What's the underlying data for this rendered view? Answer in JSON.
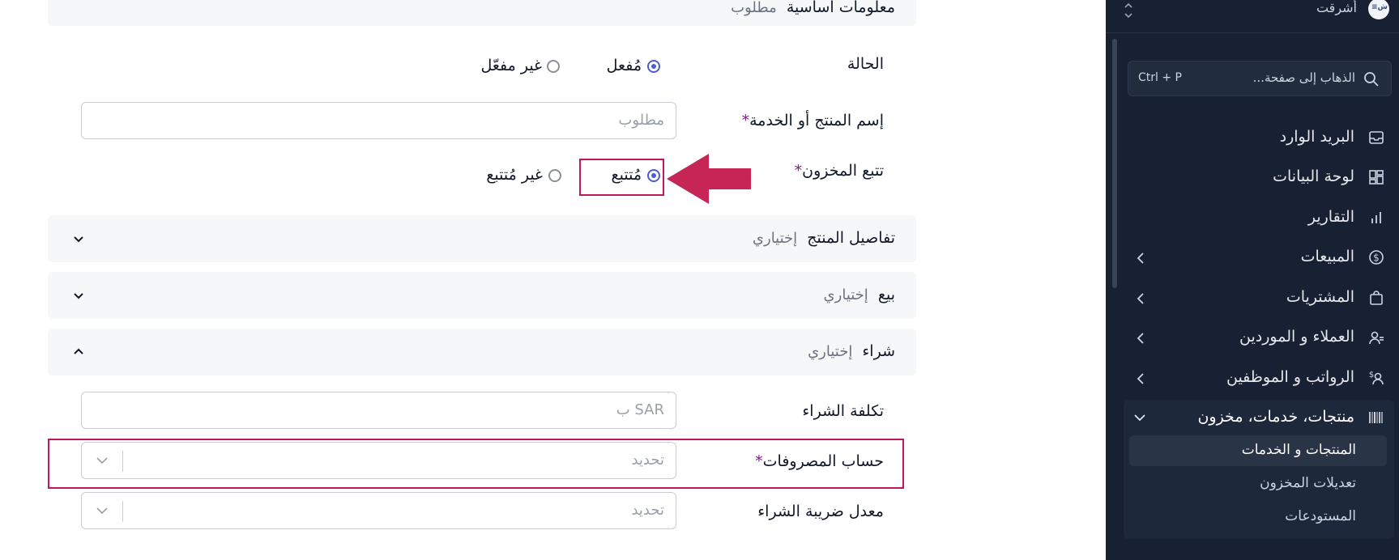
{
  "form": {
    "basic_section": {
      "title": "معلومات أساسية",
      "optional": "مطلوب"
    },
    "status": {
      "label": "الحالة",
      "option_on": "مُفعل",
      "option_off": "غير مفعّل"
    },
    "name": {
      "label": "إسم المنتج أو الخدمة",
      "required": "*",
      "placeholder": "مطلوب"
    },
    "tracking": {
      "label": "تتبع المخزون",
      "required": "*",
      "option_on": "مُتتبع",
      "option_off": "غير مُتتبع"
    },
    "details_section": {
      "title": "تفاصيل المنتج",
      "optional": "إختياري"
    },
    "sell_section": {
      "title": "بيع",
      "optional": "إختياري"
    },
    "purchase_section": {
      "title": "شراء",
      "optional": "إختياري"
    },
    "purchase_cost": {
      "label": "تكلفة الشراء",
      "placeholder": "SAR ب"
    },
    "expense_account": {
      "label": "حساب المصروفات",
      "required": "*",
      "placeholder": "تحديد"
    },
    "purchase_tax": {
      "label": "معدل ضريبة الشراء",
      "placeholder": "تحديد"
    }
  },
  "sidebar": {
    "org_name": "أشرقت",
    "search": {
      "placeholder": "الذهاب إلى صفحة...",
      "shortcut": "Ctrl + P"
    },
    "items": [
      {
        "label": "البريد الوارد",
        "icon": "inbox-icon"
      },
      {
        "label": "لوحة البيانات",
        "icon": "dashboard-icon"
      },
      {
        "label": "التقارير",
        "icon": "reports-icon"
      },
      {
        "label": "المبيعات",
        "icon": "dollar-icon"
      },
      {
        "label": "المشتريات",
        "icon": "shopping-bag-icon"
      },
      {
        "label": "العملاء و الموردين",
        "icon": "users-icon"
      },
      {
        "label": "الرواتب و الموظفين",
        "icon": "payroll-icon"
      },
      {
        "label": "منتجات، خدمات، مخزون",
        "icon": "barcode-icon"
      }
    ],
    "sub_items": [
      {
        "label": "المنتجات و الخدمات"
      },
      {
        "label": "تعديلات المخزون"
      },
      {
        "label": "المستودعات"
      }
    ]
  },
  "colors": {
    "accent": "#4f5bd5",
    "highlight": "#c2185b",
    "sidebar_bg": "#182133"
  }
}
